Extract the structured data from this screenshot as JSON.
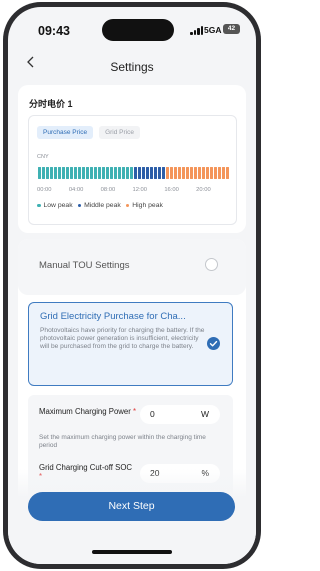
{
  "status_bar": {
    "time": "09:43",
    "network": "5GA",
    "battery": "42"
  },
  "header": {
    "title": "Settings"
  },
  "tariff": {
    "section_title": "分时电价 1",
    "tabs": [
      {
        "label": "Purchase Price",
        "active": true
      },
      {
        "label": "Grid Price",
        "active": false
      }
    ],
    "currency": "CNY",
    "time_ticks": [
      "00:00",
      "04:00",
      "08:00",
      "12:00",
      "16:00",
      "20:00"
    ],
    "periods": [
      {
        "name": "low",
        "from_hour": 0,
        "to_hour": 12,
        "color": "#3fb1b3"
      },
      {
        "name": "middle",
        "from_hour": 12,
        "to_hour": 16,
        "color": "#2c5ea8"
      },
      {
        "name": "high",
        "from_hour": 16,
        "to_hour": 24,
        "color": "#f4955a"
      }
    ],
    "legend": [
      {
        "label": "Low peak",
        "color": "#3fb1b3"
      },
      {
        "label": "Middle peak",
        "color": "#2c5ea8"
      },
      {
        "label": "High peak",
        "color": "#f4955a"
      }
    ]
  },
  "settings": {
    "manual_tou_label": "Manual TOU Settings",
    "manual_tou_selected": false,
    "grid_option": {
      "title": "Grid Electricity Purchase for Cha...",
      "description": "Photovoltaics have priority for charging the battery. If the photovoltaic power generation is insufficient, electricity will be purchased from the grid to charge the battery.",
      "selected": true
    },
    "max_power": {
      "label": "Maximum Charging Power",
      "required_mark": "*",
      "value": "0",
      "unit": "W",
      "hint": "Set the maximum charging power within the charging time period"
    },
    "cutoff_soc": {
      "label": "Grid Charging Cut-off SOC",
      "required_mark": "*",
      "value": "20",
      "unit": "%"
    }
  },
  "footer": {
    "next_label": "Next Step"
  },
  "colors": {
    "accent": "#2f6db5",
    "required": "#e03a3a"
  }
}
